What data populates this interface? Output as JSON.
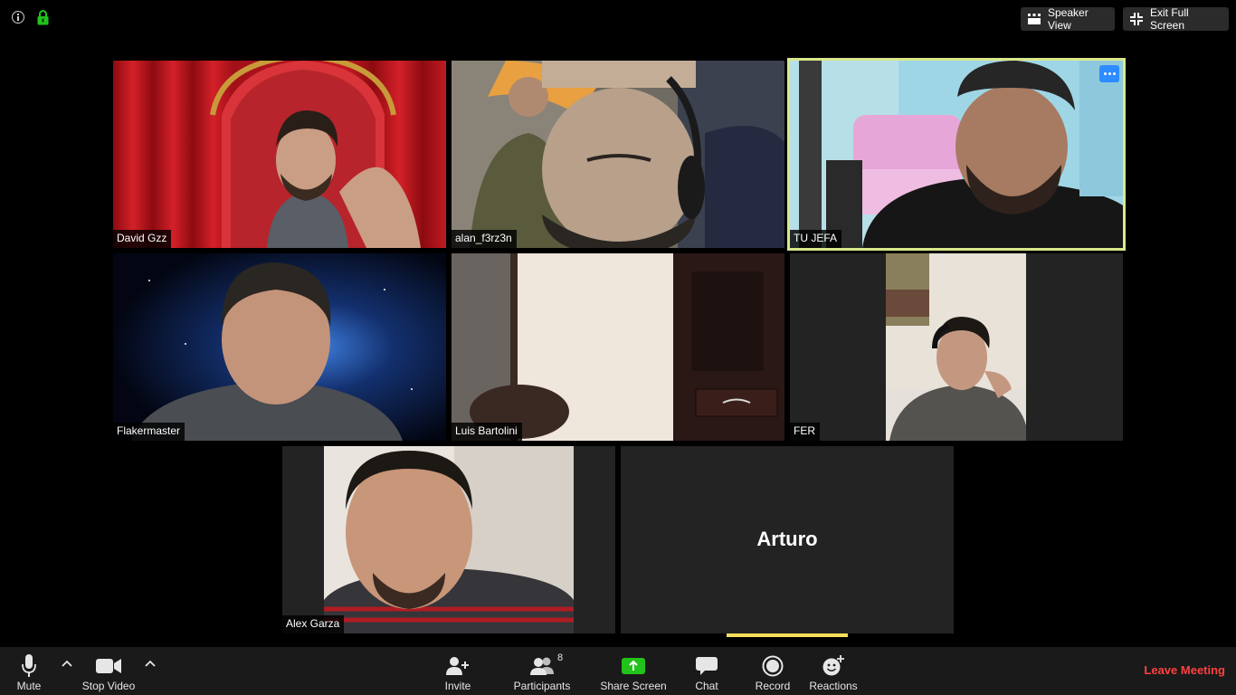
{
  "top_right": {
    "speaker_view": "Speaker View",
    "exit_full_screen": "Exit Full Screen"
  },
  "participants": [
    {
      "name": "David Gzz",
      "active": false,
      "video": true
    },
    {
      "name": "alan_f3rz3n",
      "active": false,
      "video": true
    },
    {
      "name": "TU JEFA",
      "active": true,
      "video": true
    },
    {
      "name": "Flakermaster",
      "active": false,
      "video": true
    },
    {
      "name": "Luis Bartolini",
      "active": false,
      "video": true
    },
    {
      "name": "FER",
      "active": false,
      "video": true
    },
    {
      "name": "Alex Garza",
      "active": false,
      "video": true
    },
    {
      "name": "Arturo",
      "active": false,
      "video": false
    }
  ],
  "toolbar": {
    "mute": "Mute",
    "stop_video": "Stop Video",
    "invite": "Invite",
    "participants": "Participants",
    "participants_count": "8",
    "share_screen": "Share Screen",
    "chat": "Chat",
    "record": "Record",
    "reactions": "Reactions",
    "leave_meeting": "Leave Meeting"
  },
  "colors": {
    "active_speaker_border": "#d9e88a",
    "share_screen_green": "#22c31b",
    "leave_red": "#ff4040",
    "accent_blue": "#2d8cff"
  }
}
